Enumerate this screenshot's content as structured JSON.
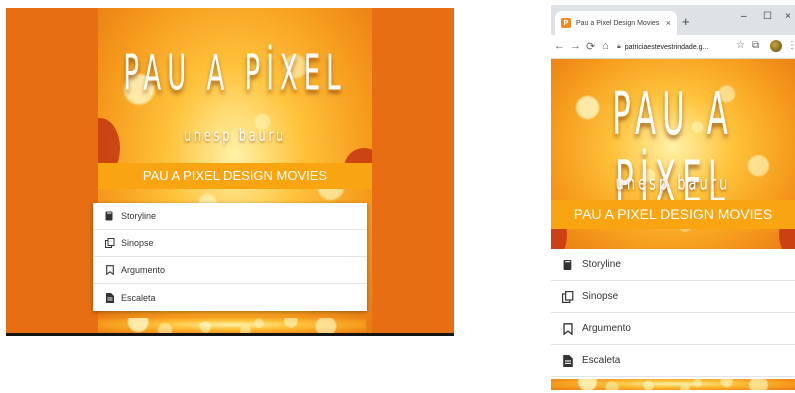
{
  "poster": {
    "title": "PAU A PİXEL",
    "subtitle": "unesp bauru",
    "banner": "PAU A PIXEL DESIGN MOVIES"
  },
  "menu": {
    "items": [
      {
        "label": "Storyline",
        "icon": "book-icon"
      },
      {
        "label": "Sinopse",
        "icon": "copy-icon"
      },
      {
        "label": "Argumento",
        "icon": "bookmark-icon"
      },
      {
        "label": "Escaleta",
        "icon": "file-text-icon"
      }
    ]
  },
  "browser": {
    "tab_title": "Pau a Pixel Design Movies",
    "favicon_letter": "P",
    "url": "patriciaestevestrindade.g...",
    "tab_close": "×",
    "new_tab": "+",
    "minimize": "–",
    "maximize": "☐",
    "close": "×"
  },
  "colors": {
    "stage_orange": "#e86e14",
    "banner": "#f9a411",
    "favicon": "#f08a24"
  }
}
